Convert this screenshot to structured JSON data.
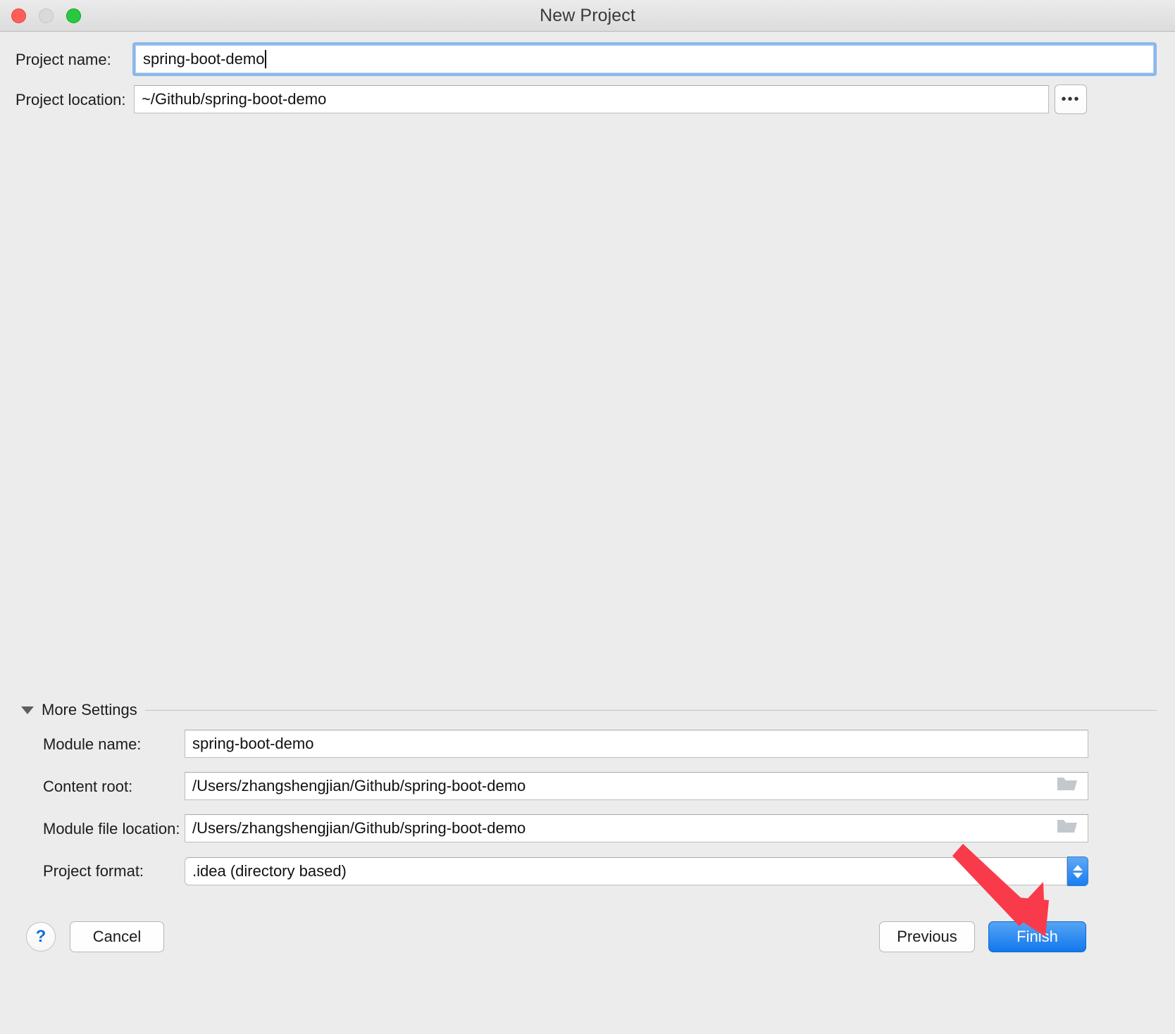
{
  "window": {
    "title": "New Project",
    "traffic_lights": [
      {
        "name": "close",
        "color": "#ff5f57"
      },
      {
        "name": "minimize",
        "color": "#d9d9d9"
      },
      {
        "name": "maximize",
        "color": "#28c840"
      }
    ]
  },
  "form": {
    "project_name": {
      "label": "Project name:",
      "value": "spring-boot-demo",
      "focused": true
    },
    "project_location": {
      "label": "Project location:",
      "value": "~/Github/spring-boot-demo",
      "browse_label": "•••"
    }
  },
  "more_settings": {
    "label": "More Settings",
    "expanded": true,
    "fields": [
      {
        "name": "module-name",
        "label": "Module name:",
        "value": "spring-boot-demo",
        "control": "text"
      },
      {
        "name": "content-root",
        "label": "Content root:",
        "value": "/Users/zhangshengjian/Github/spring-boot-demo",
        "control": "text-with-folder",
        "icon": "folder-icon"
      },
      {
        "name": "module-file-location",
        "label": "Module file location:",
        "value": "/Users/zhangshengjian/Github/spring-boot-demo",
        "control": "text-with-folder",
        "icon": "folder-icon"
      },
      {
        "name": "project-format",
        "label": "Project format:",
        "value": ".idea (directory based)",
        "control": "combo-stepper",
        "icon": "stepper-chevrons-icon"
      }
    ]
  },
  "footer": {
    "help_label": "?",
    "cancel_label": "Cancel",
    "previous_label": "Previous",
    "finish_label": "Finish"
  },
  "annotation": {
    "type": "red-arrow",
    "color": "#f93a4a",
    "points_to": "finish-button"
  },
  "colors": {
    "window_bg": "#ececec",
    "accent_blue": "#1278ee",
    "focus_ring": "#8ab8ea",
    "annotation_red": "#f93a4a"
  }
}
